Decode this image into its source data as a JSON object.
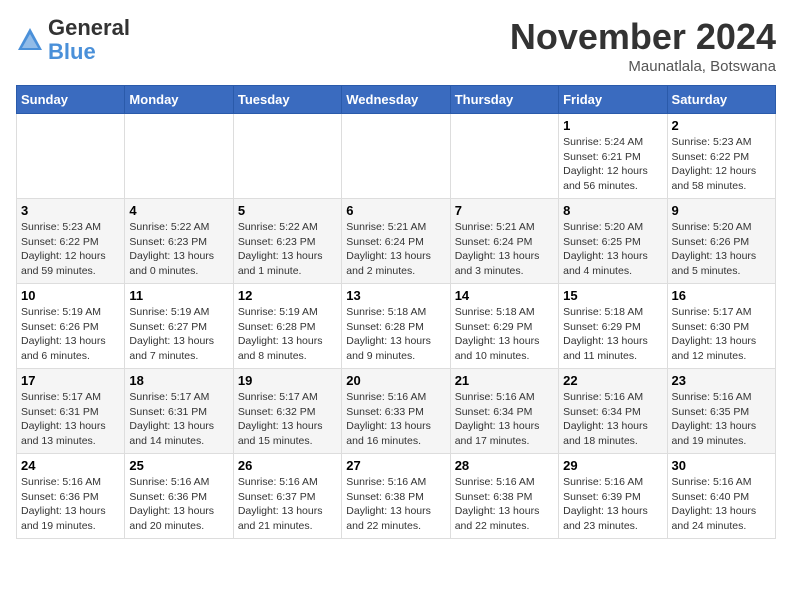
{
  "logo": {
    "general": "General",
    "blue": "Blue"
  },
  "title": "November 2024",
  "location": "Maunatlala, Botswana",
  "weekdays": [
    "Sunday",
    "Monday",
    "Tuesday",
    "Wednesday",
    "Thursday",
    "Friday",
    "Saturday"
  ],
  "weeks": [
    [
      {
        "day": "",
        "info": ""
      },
      {
        "day": "",
        "info": ""
      },
      {
        "day": "",
        "info": ""
      },
      {
        "day": "",
        "info": ""
      },
      {
        "day": "",
        "info": ""
      },
      {
        "day": "1",
        "info": "Sunrise: 5:24 AM\nSunset: 6:21 PM\nDaylight: 12 hours and 56 minutes."
      },
      {
        "day": "2",
        "info": "Sunrise: 5:23 AM\nSunset: 6:22 PM\nDaylight: 12 hours and 58 minutes."
      }
    ],
    [
      {
        "day": "3",
        "info": "Sunrise: 5:23 AM\nSunset: 6:22 PM\nDaylight: 12 hours and 59 minutes."
      },
      {
        "day": "4",
        "info": "Sunrise: 5:22 AM\nSunset: 6:23 PM\nDaylight: 13 hours and 0 minutes."
      },
      {
        "day": "5",
        "info": "Sunrise: 5:22 AM\nSunset: 6:23 PM\nDaylight: 13 hours and 1 minute."
      },
      {
        "day": "6",
        "info": "Sunrise: 5:21 AM\nSunset: 6:24 PM\nDaylight: 13 hours and 2 minutes."
      },
      {
        "day": "7",
        "info": "Sunrise: 5:21 AM\nSunset: 6:24 PM\nDaylight: 13 hours and 3 minutes."
      },
      {
        "day": "8",
        "info": "Sunrise: 5:20 AM\nSunset: 6:25 PM\nDaylight: 13 hours and 4 minutes."
      },
      {
        "day": "9",
        "info": "Sunrise: 5:20 AM\nSunset: 6:26 PM\nDaylight: 13 hours and 5 minutes."
      }
    ],
    [
      {
        "day": "10",
        "info": "Sunrise: 5:19 AM\nSunset: 6:26 PM\nDaylight: 13 hours and 6 minutes."
      },
      {
        "day": "11",
        "info": "Sunrise: 5:19 AM\nSunset: 6:27 PM\nDaylight: 13 hours and 7 minutes."
      },
      {
        "day": "12",
        "info": "Sunrise: 5:19 AM\nSunset: 6:28 PM\nDaylight: 13 hours and 8 minutes."
      },
      {
        "day": "13",
        "info": "Sunrise: 5:18 AM\nSunset: 6:28 PM\nDaylight: 13 hours and 9 minutes."
      },
      {
        "day": "14",
        "info": "Sunrise: 5:18 AM\nSunset: 6:29 PM\nDaylight: 13 hours and 10 minutes."
      },
      {
        "day": "15",
        "info": "Sunrise: 5:18 AM\nSunset: 6:29 PM\nDaylight: 13 hours and 11 minutes."
      },
      {
        "day": "16",
        "info": "Sunrise: 5:17 AM\nSunset: 6:30 PM\nDaylight: 13 hours and 12 minutes."
      }
    ],
    [
      {
        "day": "17",
        "info": "Sunrise: 5:17 AM\nSunset: 6:31 PM\nDaylight: 13 hours and 13 minutes."
      },
      {
        "day": "18",
        "info": "Sunrise: 5:17 AM\nSunset: 6:31 PM\nDaylight: 13 hours and 14 minutes."
      },
      {
        "day": "19",
        "info": "Sunrise: 5:17 AM\nSunset: 6:32 PM\nDaylight: 13 hours and 15 minutes."
      },
      {
        "day": "20",
        "info": "Sunrise: 5:16 AM\nSunset: 6:33 PM\nDaylight: 13 hours and 16 minutes."
      },
      {
        "day": "21",
        "info": "Sunrise: 5:16 AM\nSunset: 6:34 PM\nDaylight: 13 hours and 17 minutes."
      },
      {
        "day": "22",
        "info": "Sunrise: 5:16 AM\nSunset: 6:34 PM\nDaylight: 13 hours and 18 minutes."
      },
      {
        "day": "23",
        "info": "Sunrise: 5:16 AM\nSunset: 6:35 PM\nDaylight: 13 hours and 19 minutes."
      }
    ],
    [
      {
        "day": "24",
        "info": "Sunrise: 5:16 AM\nSunset: 6:36 PM\nDaylight: 13 hours and 19 minutes."
      },
      {
        "day": "25",
        "info": "Sunrise: 5:16 AM\nSunset: 6:36 PM\nDaylight: 13 hours and 20 minutes."
      },
      {
        "day": "26",
        "info": "Sunrise: 5:16 AM\nSunset: 6:37 PM\nDaylight: 13 hours and 21 minutes."
      },
      {
        "day": "27",
        "info": "Sunrise: 5:16 AM\nSunset: 6:38 PM\nDaylight: 13 hours and 22 minutes."
      },
      {
        "day": "28",
        "info": "Sunrise: 5:16 AM\nSunset: 6:38 PM\nDaylight: 13 hours and 22 minutes."
      },
      {
        "day": "29",
        "info": "Sunrise: 5:16 AM\nSunset: 6:39 PM\nDaylight: 13 hours and 23 minutes."
      },
      {
        "day": "30",
        "info": "Sunrise: 5:16 AM\nSunset: 6:40 PM\nDaylight: 13 hours and 24 minutes."
      }
    ]
  ]
}
